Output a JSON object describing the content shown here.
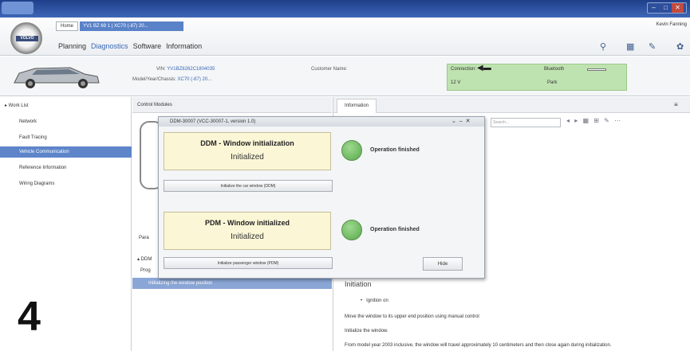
{
  "window": {
    "controls": {
      "minimize": "–",
      "maximize": "□",
      "close": "✕"
    }
  },
  "header": {
    "logo_text": "VOLVO",
    "tabs": [
      {
        "label": "Home"
      },
      {
        "label": "YV1 BZ 69 1 | XC70 (-87) 20..."
      }
    ],
    "user_name": "Kevin Fanning",
    "menu": [
      "Planning",
      "Diagnostics",
      "Software",
      "Information"
    ],
    "active_menu": "Diagnostics",
    "tool_icons": [
      "search-icon",
      "grid-icon",
      "tools-icon",
      "gear-icon"
    ]
  },
  "vehicle": {
    "vin_label": "VIN:",
    "vin_value": "YV1BZ8262C1804035",
    "model_label": "Model/Year/Chassis:",
    "model_value": "XC70 (-87) 20...",
    "customer_label": "Customer Name:",
    "connection_label": "Connection:",
    "bluetooth_label": "Bluetooth",
    "voltage_label": "12 V",
    "park_label": "Park"
  },
  "sidebar": {
    "items": [
      {
        "label": "▸ Work List",
        "active": false
      },
      {
        "label": "Network",
        "active": false
      },
      {
        "label": "Fault Tracing",
        "active": false
      },
      {
        "label": "Vehicle Communication",
        "active": true
      },
      {
        "label": "Reference Information",
        "active": false
      },
      {
        "label": "Wiring Diagrams",
        "active": false
      }
    ]
  },
  "center": {
    "header": "Control Modules",
    "param_tab": "Para",
    "tree_ddm": "▴ DDM",
    "tree_prog": "Prog",
    "selected_row": "Initializing the window position"
  },
  "info": {
    "tab": "Information",
    "close": "≡",
    "search_placeholder": "Search...",
    "toolbar": "◂ ▸ ▦ ⊞ ✎ ⋯",
    "heading": "Initiation",
    "bullet": "Ignition on",
    "line_1": "Move the window to its upper end position using manual control",
    "line_2": "Initialize the window.",
    "line_3": "From model year 2003 inclusive, the window will travel approximately 10 centimeters and then close again during initialization."
  },
  "dialog": {
    "title": "DDM-30007 (VCC-30007-1, version 1.0)",
    "controls": "⌄ ‒ ✕",
    "box1": {
      "title": "DDM - Window initialization",
      "state": "Initialized"
    },
    "box1_status": "Operation finished",
    "box1_button": "Initialize the car window (DDM)",
    "box2": {
      "title": "PDM - Window initialized",
      "state": "Initialized"
    },
    "box2_status": "Operation finished",
    "box2_button": "Initialize passenger window (PDM)",
    "hide_button": "Hide"
  },
  "step_number": "4",
  "colors": {
    "titlebar": "#1f3f8a",
    "accent": "#5e85c9",
    "status_green": "#bfe3b0",
    "dialog_box": "#fbf6d6",
    "ok_circle": "#58a94a"
  }
}
